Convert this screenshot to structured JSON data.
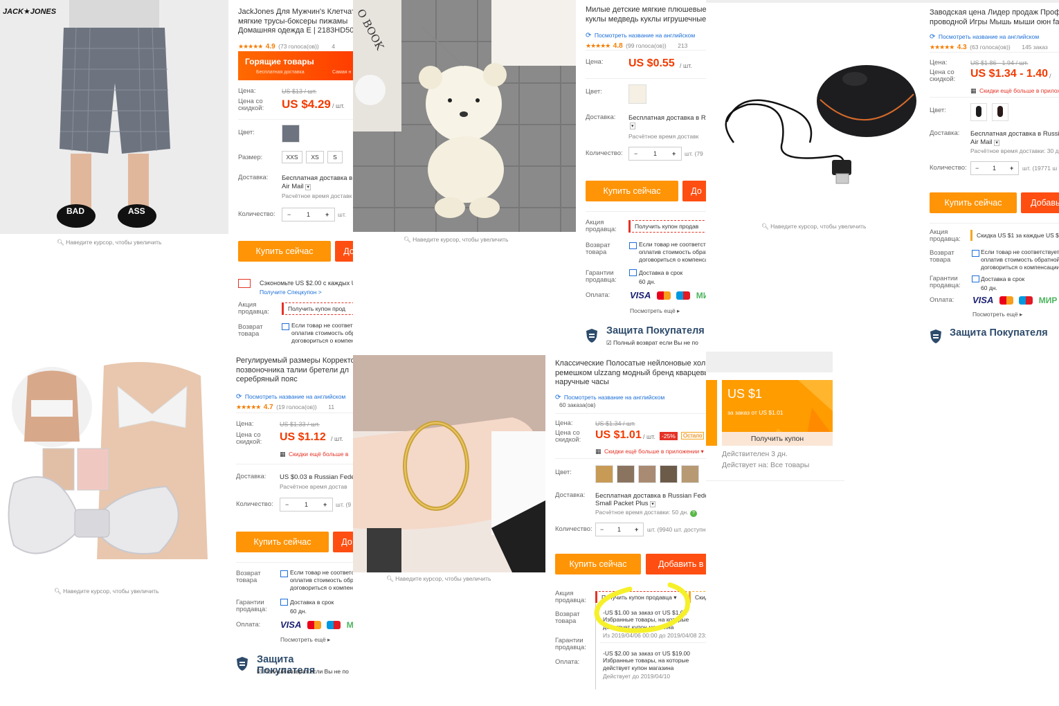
{
  "common": {
    "zoom_hint": "Наведите курсор, чтобы увеличить",
    "price_label": "Цена:",
    "discount_price_label": "Цена со\nскидкой:",
    "color_label": "Цвет:",
    "size_label": "Размер:",
    "delivery_label": "Доставка:",
    "qty_label": "Количество:",
    "seller_promo_label": "Акция\nпродавца:",
    "return_label": "Возврат\nтовара",
    "guarantee_label": "Гарантии\nпродавца:",
    "payment_label": "Оплата:",
    "buy_now": "Купить сейчас",
    "add_to_cart_short": "До",
    "add_to_cart": "Добавь",
    "add_to_cart_full": "Добавить в к",
    "translate_link": "Посмотреть название на английском",
    "get_coupon": "Получить купон продавца",
    "return_text": "Если товар не соответствует\nоплатив стоимость обратной\nдоговориться о компенсации",
    "guarantee_text": "Доставка в срок\n60 дн.",
    "see_more": "Посмотреть ещё ▸",
    "buyer_protection": "Защита Покупателя",
    "full_refund": "Полный возврат если Вы не по",
    "per_unit": "/ шт.",
    "visa": "VISA",
    "mir": "МИР",
    "pieces_suffix": "шт."
  },
  "tile1": {
    "brand_logo": "JACK★JONES",
    "title": "JackJones Для Мужчин's Клетчатые\nмягкие трусы-боксеры пижамы\nДомашняя одежда E | 2183HD50",
    "rating": "4.9",
    "votes": "(73 голоса(ов))",
    "orders": "4",
    "hot_banner": "Горящие товары",
    "hot_sub": "Бесплатная доставка",
    "hot_sub2": "Самая н",
    "old_price": "US $13 / шт.",
    "price": "US $4.29",
    "sizes": [
      "XXS",
      "XS",
      "S"
    ],
    "delivery": "Бесплатная доставка в",
    "delivery_method": "Air Mail",
    "delivery_time": "Расчётное время доставк",
    "qty": "1",
    "save_text": "Сэкономьте US $2.00 с каждых U",
    "special_coupon": "Получите Спецкупон >",
    "coupon": "Получить купон прод",
    "sandal_left": "BAD",
    "sandal_right": "ASS"
  },
  "tile2": {
    "title": "Милые детские мягкие плюшевые\nкуклы медведь куклы игрушечные",
    "rating": "4.8",
    "votes": "(99 голоса(ов))",
    "orders": "213",
    "price": "US $0.55",
    "delivery": "Бесплатная доставка в R",
    "delivery_time": "Расчётное время доставк",
    "qty": "1",
    "stock": "шт. (79",
    "coupon": "Получить купон продав",
    "book_text": "O BOOK"
  },
  "tile3": {
    "title": "Заводская цена Лидер продаж Профес\nпроводной Игры Мышь мыши оюн fa",
    "rating": "4.3",
    "votes": "(63 голоса(ов))",
    "orders": "145 заказ",
    "old_price": "US $1.86 - 1.94 / шт.",
    "price": "US $1.34 - 1.40",
    "app_discount": "Скидки ещё больше в прилож",
    "delivery": "Бесплатная доставка в Russian",
    "delivery_method": "Air Mail",
    "delivery_time": "Расчётное время доставки: 30 д",
    "qty": "1",
    "stock": "шт. (19771 ш",
    "coupon": "Скидка US $1 за каждые US $5"
  },
  "tile4": {
    "title": "Регулируемый размеры Корректо\nпозвоночника талии бретели дл\nсеребряный пояс",
    "rating": "4.7",
    "votes": "(19 голоса(ов))",
    "orders": "11",
    "old_price": "US $1.33 / шт.",
    "price": "US $1.12",
    "app_discount": "Скидки ещё больше в",
    "delivery": "US $0.03 в Russian Fede",
    "delivery_time": "Расчётное время достав",
    "qty": "1",
    "stock": "шт. (9"
  },
  "tile5": {
    "title": "Классические Полосатые нейлоновые холщо\nремешком ulzzang модный бренд кварцевые\nнаручные часы",
    "orders": "60 заказа(ов)",
    "old_price": "US $1.34 / шт.",
    "price": "US $1.01",
    "discount": "-25%",
    "remaining": "Остало",
    "app_discount": "Скидки ещё больше в приложении ▾",
    "delivery": "Бесплатная доставка в Russian Federa",
    "delivery_method": "Small Packet Plus",
    "delivery_time": "Расчётное время доставки: 50 дн.",
    "qty": "1",
    "stock": "шт. (9940 шт. доступн",
    "coupon_btn": "Получить купон продавца ▾",
    "coupon_btn2": "Скид",
    "coupon1_title": "-US $1.00 за заказ от US $1.01",
    "coupon1_desc": "Избранные товары, на которые\nдействует купон магазина",
    "coupon1_dates": "Из 2019/04/06 00:00 до 2019/04/08 23:",
    "coupon2_title": "-US $2.00 за заказ от US $19.00",
    "coupon2_desc": "Избранные товары, на которые\nдействует купон магазина",
    "coupon2_dates": "Действует до 2019/04/10"
  },
  "tile6": {
    "amount": "US $1",
    "condition": "за заказ от US $1.01",
    "get": "Получить купон",
    "valid_days": "Действителен 3 дн.",
    "applies": "Действует на: Все товары"
  },
  "colors": {
    "orange": "#ff9406",
    "red_orange": "#ff4e11",
    "price_red": "#f23a00",
    "highlight": "#f6f02a",
    "coupon_card": "#ff9c00"
  }
}
